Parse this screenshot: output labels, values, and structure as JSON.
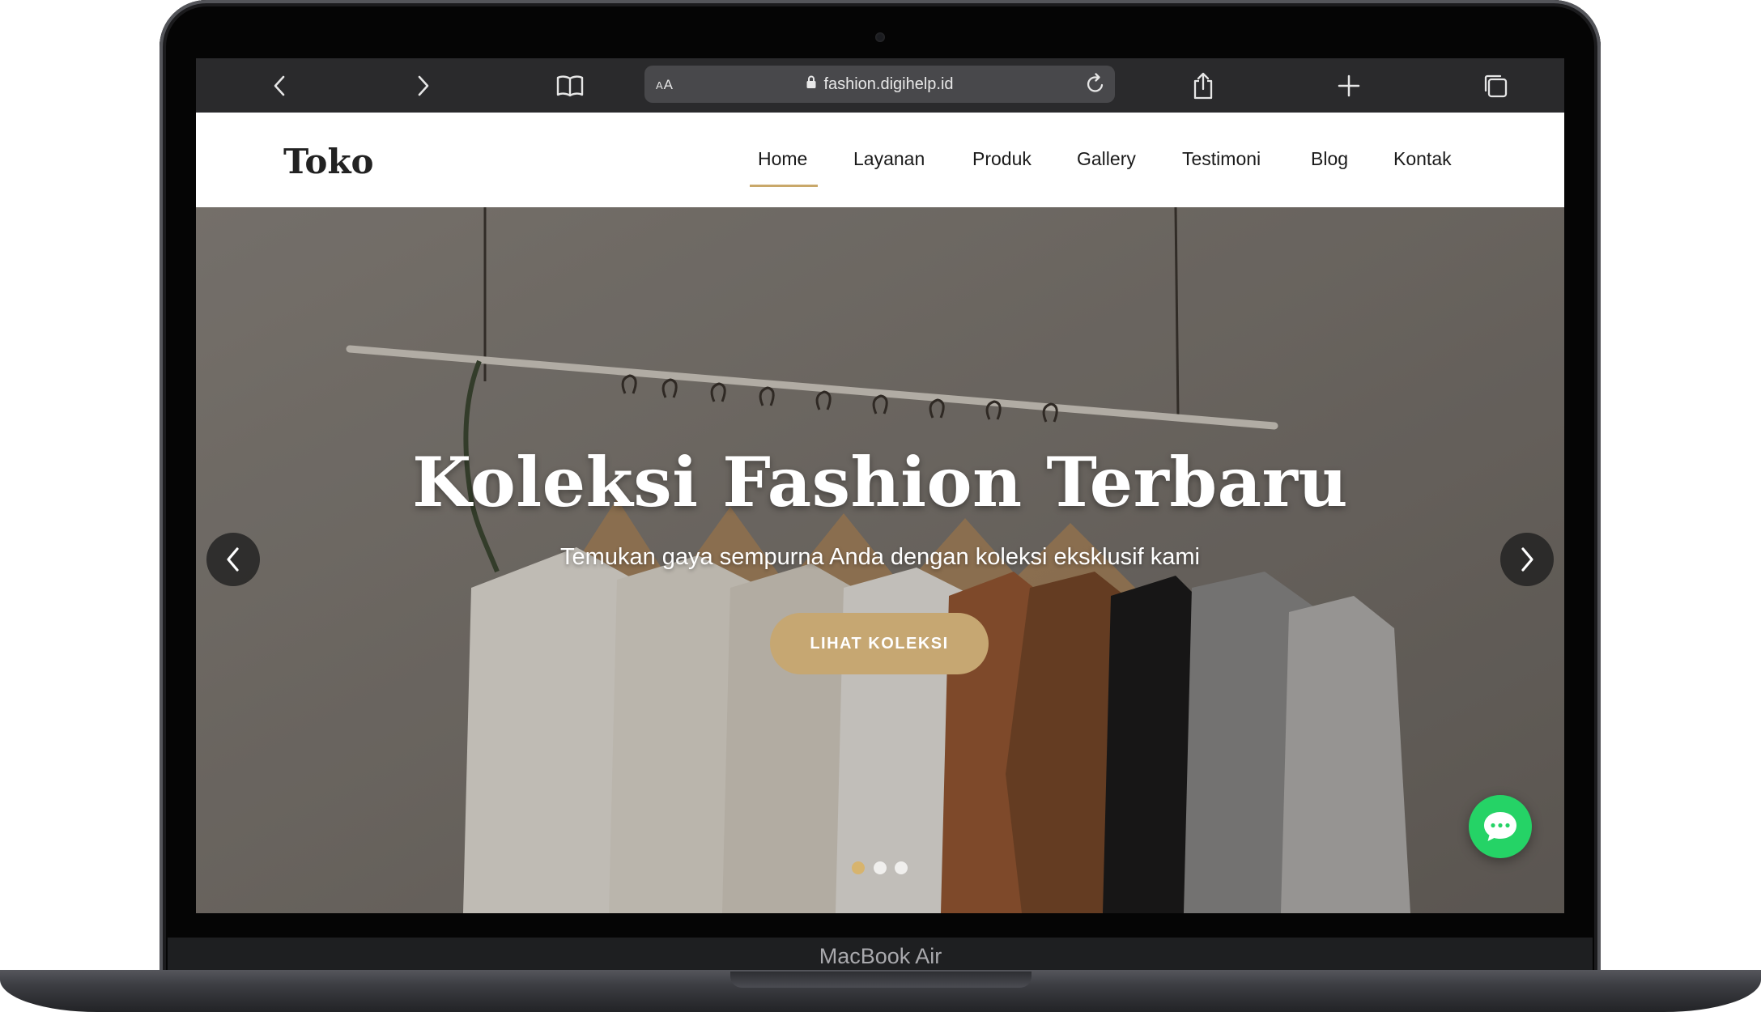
{
  "browser": {
    "url": "fashion.digihelp.id",
    "reader_label_small": "A",
    "reader_label_large": "A"
  },
  "site": {
    "logo": "Toko",
    "nav": [
      {
        "label": "Home",
        "active": true
      },
      {
        "label": "Layanan"
      },
      {
        "label": "Produk"
      },
      {
        "label": "Gallery"
      },
      {
        "label": "Testimoni"
      },
      {
        "label": "Blog"
      },
      {
        "label": "Kontak"
      }
    ],
    "hero": {
      "title": "Koleksi Fashion Terbaru",
      "subtitle": "Temukan gaya sempurna Anda dengan koleksi eksklusif kami",
      "cta": "LIHAT KOLEKSI",
      "slide_count": 3,
      "active_slide": 1
    }
  },
  "device": {
    "label": "MacBook Air"
  },
  "colors": {
    "accent": "#c6a772",
    "active_dot": "#d7b46e",
    "chat": "#25d366",
    "toolbar": "#2a2a2c"
  },
  "icons": [
    "back-icon",
    "forward-icon",
    "bookmarks-icon",
    "lock-icon",
    "reload-icon",
    "share-icon",
    "new-tab-icon",
    "tabs-icon",
    "chevron-left-icon",
    "chevron-right-icon",
    "chat-icon"
  ]
}
